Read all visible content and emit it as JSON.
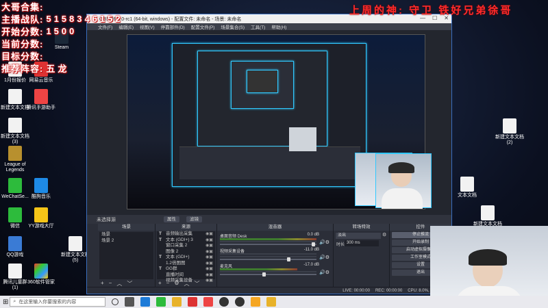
{
  "overlay": {
    "left_rows": [
      {
        "label": "大哥合集:",
        "value": ""
      },
      {
        "label": "主播战队:",
        "value": "5158346152"
      },
      {
        "label": "开始分数:",
        "value": "1500"
      },
      {
        "label": "当前分数:",
        "value": ""
      },
      {
        "label": "目标分数:",
        "value": ""
      },
      {
        "label": "推荐阵容:",
        "value": "五龙"
      }
    ],
    "top_right": "上周的神:  守卫  铁好兄弟徐哥",
    "colors": {
      "overlay_red": "#ff2b2b",
      "obs_bg": "#2b2e38",
      "accent_blue": "#30c8ff",
      "window_border": "#3a6fc0"
    }
  },
  "desktop_icons": [
    {
      "label": "",
      "icon": "app-icon"
    },
    {
      "label": "Steam",
      "icon": "steam-icon"
    },
    {
      "label": "1月份报价",
      "icon": "doc-icon"
    },
    {
      "label": "网易云音乐",
      "icon": "music-icon"
    },
    {
      "label": "新建文本文档",
      "icon": "txt-icon"
    },
    {
      "label": "腾讯手游助手",
      "icon": "game-icon"
    },
    {
      "label": "新建文本文档 (3)",
      "icon": "txt-icon"
    },
    {
      "label": "League of Legends",
      "icon": "lol-icon"
    },
    {
      "label": "WeChatSe...",
      "icon": "wechat-icon"
    },
    {
      "label": "酷狗音乐",
      "icon": "kugou-icon"
    },
    {
      "label": "微信",
      "icon": "wechat-icon"
    },
    {
      "label": "YY游戏大厅",
      "icon": "yy-icon"
    },
    {
      "label": "QQ游戏",
      "icon": "qq-icon"
    },
    {
      "label": "新建文本文档 (5)",
      "icon": "txt-icon"
    },
    {
      "label": "腾讯儿童群 (1)",
      "icon": "txt-icon"
    },
    {
      "label": "360软件管家",
      "icon": "360-icon"
    }
  ],
  "right_icons": [
    {
      "label": "新建文本文档 (2)"
    },
    {
      "label": "文本文档"
    },
    {
      "label": "新建文本文档"
    }
  ],
  "obs": {
    "title": "OBS 26.1.0-rc1 (64-bit, windows) - 配置文件: 未命名 - 场景: 未命名",
    "menu": [
      "文件(F)",
      "编辑(E)",
      "视图(V)",
      "停靠部件(D)",
      "配置文件(P)",
      "场景集合(S)",
      "工具(T)",
      "帮助(H)"
    ],
    "source_bar": {
      "label": "未选择源",
      "props": "属性",
      "filters": "滤镜"
    },
    "docks": {
      "scenes_title": "场景",
      "scenes": [
        "场景",
        "场景 2"
      ],
      "sources_title": "来源",
      "sources": [
        {
          "icon": "T",
          "name": "音频输出采集"
        },
        {
          "icon": "T",
          "name": "文本 (GDI+) 3"
        },
        {
          "icon": "",
          "name": "窗口采集 2"
        },
        {
          "icon": "",
          "name": "图像 2"
        },
        {
          "icon": "T",
          "name": "文本 (GDI+)"
        },
        {
          "icon": "",
          "name": "1.2倍图图"
        },
        {
          "icon": "T",
          "name": "GG群"
        },
        {
          "icon": "",
          "name": "直播时间"
        },
        {
          "icon": "",
          "name": "视频采集设备"
        }
      ],
      "mixer_title": "混音器",
      "mixer": [
        {
          "name": "桌面音频 Desk",
          "db": "0.0 dB"
        },
        {
          "name": "视频采集设备",
          "db": "-11.0 dB"
        },
        {
          "name": "麦克风",
          "db": "-17.0 dB"
        }
      ],
      "transitions_title": "转场特效",
      "transition_type": "淡出",
      "duration_label": "时长",
      "duration_value": "300 ms",
      "controls_title": "控件",
      "controls": [
        "停止推流",
        "开始录制",
        "启动虚拟摄像机",
        "工作室模式",
        "设置",
        "退出"
      ]
    },
    "status": {
      "live": "LIVE: 00:00:00",
      "rec": "REC: 00:00:00",
      "cpu": "CPU: 8.0%, 30.00 fps"
    }
  },
  "taskbar": {
    "search_placeholder": "在这里输入你要搜索的内容"
  }
}
